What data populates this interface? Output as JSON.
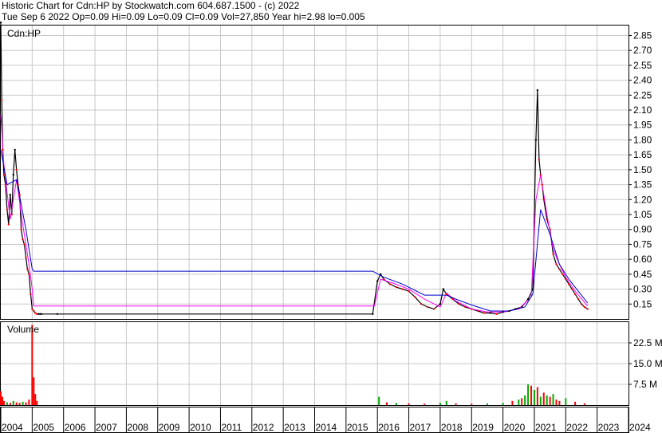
{
  "header": {
    "line1": "Historic Chart for Cdn:HP by Stockwatch.com 604.687.1500 - (c) 2022",
    "line2": "Tue Sep  6 2022  Op=0.09  Hi=0.09  Lo=0.09  Cl=0.09  Vol=27,850  Year hi=2.98  lo=0.005"
  },
  "colors": {
    "price": "#000000",
    "ma_short": "#ff00ff",
    "ma_long": "#0000cc",
    "down_close": "#ff0000",
    "vol_up": "#00aa00",
    "vol_down": "#ff0000",
    "grid": "#c8c8c8"
  },
  "chart_data": [
    {
      "type": "line",
      "symbol_label": "Cdn:HP",
      "y_ticks": [
        "2.85",
        "2.70",
        "2.55",
        "2.40",
        "2.25",
        "2.10",
        "1.95",
        "1.80",
        "1.65",
        "1.50",
        "1.35",
        "1.20",
        "1.05",
        "0.90",
        "0.75",
        "0.60",
        "0.45",
        "0.30",
        "0.15"
      ],
      "ylim": [
        0,
        2.95
      ],
      "xlim": [
        2004.0,
        2024.0
      ],
      "x_tick_labels": [
        "2004",
        "2005",
        "2006",
        "2007",
        "2008",
        "2009",
        "2010",
        "2011",
        "2012",
        "2013",
        "2014",
        "2015",
        "2016",
        "2017",
        "2018",
        "2019",
        "2020",
        "2021",
        "2022",
        "2023",
        "2024"
      ],
      "series": [
        {
          "role": "price",
          "x": [
            2004.0,
            2004.03,
            2004.06,
            2004.1,
            2004.15,
            2004.2,
            2004.25,
            2004.3,
            2004.35,
            2004.4,
            2004.45,
            2004.5,
            2004.55,
            2004.6,
            2004.65,
            2004.7,
            2004.75,
            2004.8,
            2004.85,
            2004.9,
            2004.95,
            2005.0,
            2005.05,
            2005.1,
            2005.15,
            2005.2,
            2005.25,
            2005.3,
            2005.8,
            2015.85,
            2016.0,
            2016.1,
            2016.2,
            2016.4,
            2016.6,
            2016.8,
            2017.0,
            2017.2,
            2017.4,
            2017.6,
            2017.8,
            2018.0,
            2018.1,
            2018.2,
            2018.4,
            2018.6,
            2018.8,
            2019.0,
            2019.2,
            2019.4,
            2019.6,
            2019.8,
            2020.0,
            2020.2,
            2020.4,
            2020.6,
            2020.8,
            2020.95,
            2021.05,
            2021.1,
            2021.15,
            2021.2,
            2021.25,
            2021.3,
            2021.4,
            2021.5,
            2021.6,
            2021.7,
            2021.8,
            2021.9,
            2022.0,
            2022.1,
            2022.2,
            2022.3,
            2022.4,
            2022.5,
            2022.6,
            2022.7
          ],
          "y": [
            2.98,
            2.2,
            1.7,
            1.45,
            1.35,
            1.1,
            0.95,
            1.25,
            1.05,
            1.45,
            1.7,
            1.5,
            1.35,
            1.25,
            0.9,
            0.8,
            0.75,
            0.62,
            0.5,
            0.45,
            0.25,
            0.1,
            0.08,
            0.06,
            0.05,
            0.05,
            0.05,
            0.05,
            0.05,
            0.05,
            0.38,
            0.45,
            0.4,
            0.35,
            0.32,
            0.3,
            0.28,
            0.22,
            0.15,
            0.12,
            0.1,
            0.15,
            0.3,
            0.25,
            0.2,
            0.15,
            0.12,
            0.1,
            0.08,
            0.06,
            0.06,
            0.05,
            0.07,
            0.08,
            0.1,
            0.12,
            0.2,
            0.3,
            1.8,
            2.3,
            1.6,
            1.45,
            1.35,
            1.2,
            1.0,
            0.9,
            0.65,
            0.55,
            0.5,
            0.45,
            0.4,
            0.35,
            0.3,
            0.25,
            0.2,
            0.15,
            0.12,
            0.1
          ]
        },
        {
          "role": "ma_short",
          "x": [
            2004.0,
            2004.1,
            2004.3,
            2004.5,
            2004.7,
            2004.9,
            2005.0,
            2005.05,
            2015.8,
            2015.9,
            2016.1,
            2016.5,
            2017.0,
            2017.5,
            2018.0,
            2018.2,
            2018.5,
            2019.0,
            2019.5,
            2020.0,
            2020.5,
            2020.9,
            2021.05,
            2021.2,
            2021.4,
            2021.6,
            2021.8,
            2022.0,
            2022.3,
            2022.7
          ],
          "y": [
            2.05,
            1.55,
            1.0,
            1.4,
            0.95,
            0.55,
            0.3,
            0.13,
            0.13,
            0.13,
            0.4,
            0.36,
            0.3,
            0.2,
            0.12,
            0.26,
            0.18,
            0.1,
            0.07,
            0.07,
            0.1,
            0.22,
            1.2,
            1.45,
            1.05,
            0.7,
            0.55,
            0.42,
            0.28,
            0.13
          ]
        },
        {
          "role": "ma_long",
          "x": [
            2004.0,
            2004.2,
            2004.5,
            2004.8,
            2005.0,
            2005.05,
            2015.85,
            2016.2,
            2016.8,
            2017.5,
            2018.2,
            2018.5,
            2019.0,
            2019.6,
            2020.2,
            2020.7,
            2020.95,
            2021.2,
            2021.5,
            2021.8,
            2022.1,
            2022.4,
            2022.7
          ],
          "y": [
            1.7,
            1.35,
            1.4,
            0.9,
            0.5,
            0.48,
            0.48,
            0.42,
            0.35,
            0.24,
            0.24,
            0.2,
            0.14,
            0.08,
            0.08,
            0.12,
            0.25,
            1.1,
            0.85,
            0.55,
            0.4,
            0.28,
            0.16
          ]
        }
      ]
    },
    {
      "type": "bar",
      "label": "Volume",
      "y_ticks": [
        "22.5 M",
        "15.0 M",
        "7.5 M"
      ],
      "ylim": [
        0,
        30
      ],
      "xlim": [
        2004.0,
        2024.0
      ],
      "x": [
        2004.0,
        2004.05,
        2004.1,
        2004.2,
        2004.3,
        2004.4,
        2004.5,
        2004.6,
        2004.7,
        2004.8,
        2004.9,
        2005.0,
        2005.05,
        2005.1,
        2005.15,
        2016.05,
        2016.3,
        2016.6,
        2017.0,
        2017.5,
        2018.0,
        2018.2,
        2018.5,
        2019.0,
        2019.5,
        2020.0,
        2020.3,
        2020.5,
        2020.6,
        2020.7,
        2020.8,
        2020.9,
        2021.0,
        2021.1,
        2021.2,
        2021.3,
        2021.4,
        2021.5,
        2021.6,
        2021.7,
        2021.8,
        2022.0,
        2022.3,
        2022.6
      ],
      "values": [
        5.0,
        3.0,
        1.5,
        1.0,
        0.8,
        1.5,
        1.0,
        0.8,
        1.2,
        1.0,
        2.0,
        29.0,
        10.0,
        4.0,
        1.5,
        3.0,
        1.0,
        0.8,
        0.6,
        0.5,
        0.8,
        1.5,
        0.6,
        0.5,
        0.6,
        0.8,
        1.5,
        2.0,
        2.5,
        3.5,
        7.5,
        7.0,
        5.5,
        6.5,
        3.0,
        4.5,
        3.5,
        3.0,
        4.0,
        2.0,
        1.5,
        2.5,
        1.2,
        0.6
      ],
      "colors": [
        "red",
        "red",
        "red",
        "green",
        "red",
        "green",
        "red",
        "red",
        "green",
        "red",
        "red",
        "red",
        "red",
        "red",
        "red",
        "green",
        "red",
        "green",
        "red",
        "red",
        "green",
        "green",
        "red",
        "red",
        "green",
        "green",
        "red",
        "green",
        "red",
        "green",
        "green",
        "red",
        "green",
        "red",
        "green",
        "red",
        "green",
        "red",
        "green",
        "red",
        "red",
        "green",
        "red",
        "red"
      ]
    }
  ]
}
